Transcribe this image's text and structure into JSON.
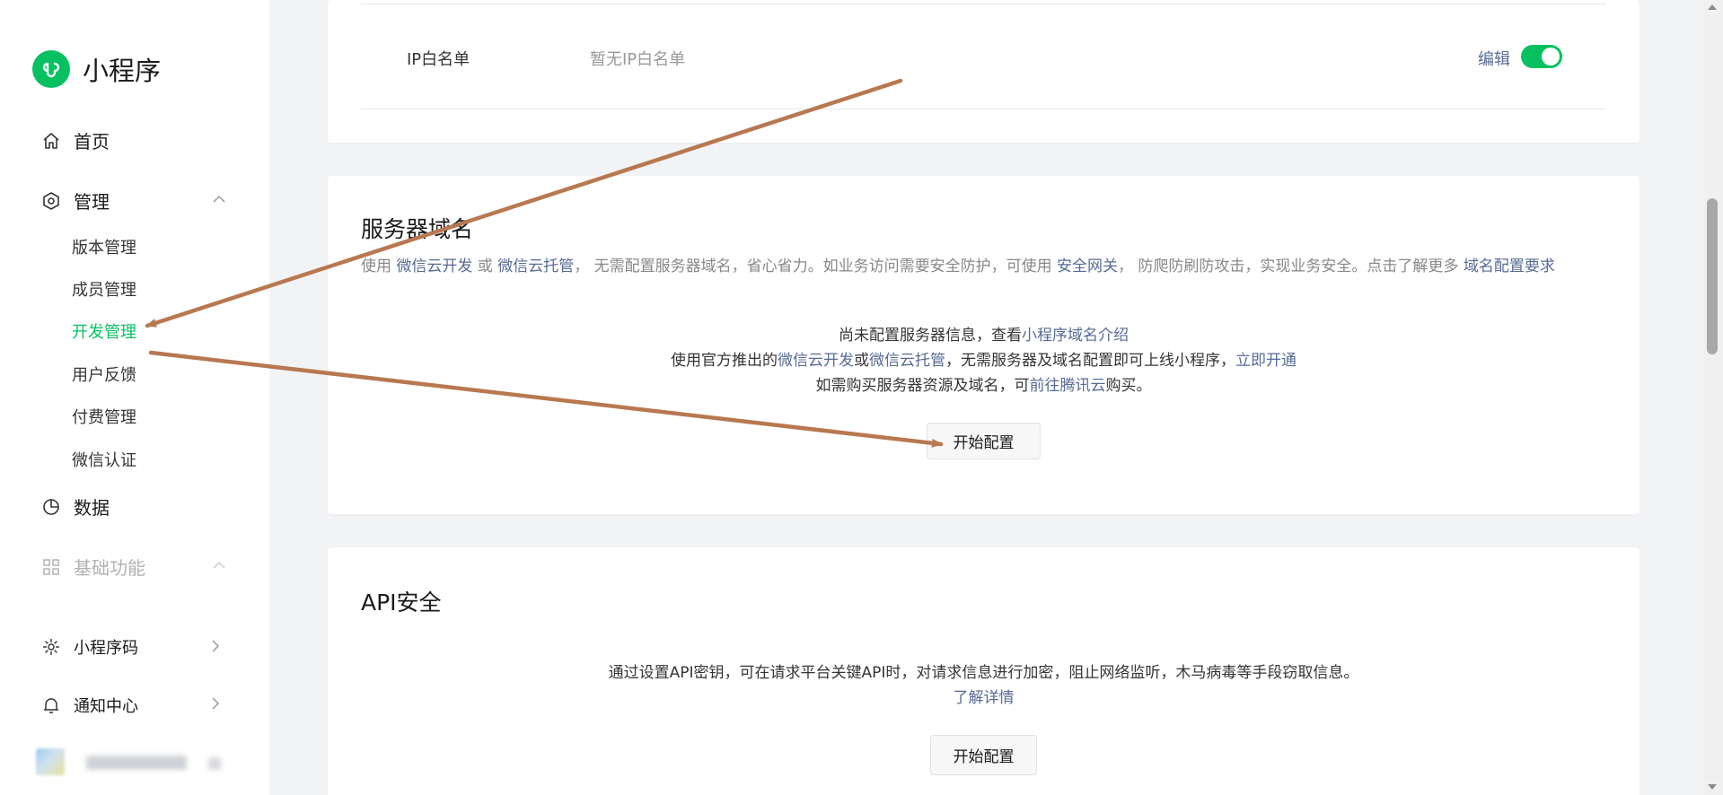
{
  "brand": {
    "name": "小程序",
    "logo_icon": "miniprogram-logo-icon",
    "color": "#07c160"
  },
  "sidebar": {
    "home": {
      "label": "首页",
      "icon": "home-icon"
    },
    "manage": {
      "label": "管理",
      "icon": "manage-icon",
      "items": [
        {
          "label": "版本管理"
        },
        {
          "label": "成员管理"
        },
        {
          "label": "开发管理",
          "active": true
        },
        {
          "label": "用户反馈"
        },
        {
          "label": "付费管理"
        },
        {
          "label": "微信认证"
        }
      ]
    },
    "data": {
      "label": "数据",
      "icon": "pie-chart-icon"
    },
    "basic": {
      "label": "基础功能",
      "icon": "grid-icon"
    },
    "qrcode": {
      "label": "小程序码",
      "icon": "qrcode-icon"
    },
    "notify": {
      "label": "通知中心",
      "icon": "bell-icon"
    }
  },
  "ip_whitelist": {
    "label": "IP白名单",
    "value": "暂无IP白名单",
    "edit": "编辑",
    "toggle_on": true
  },
  "server": {
    "title": "服务器域名",
    "desc_prefix": "使用 ",
    "desc_link1": "微信云开发",
    "desc_or": " 或 ",
    "desc_link2": "微信云托管",
    "desc_mid": "， 无需配置服务器域名，省心省力。如业务访问需要安全防护，可使用 ",
    "desc_link3": "安全网关",
    "desc_mid2": "， 防爬防刷防攻击，实现业务安全。点击了解更多 ",
    "desc_link4": "域名配置要求",
    "line1_prefix": "尚未配置服务器信息，查看",
    "line1_link": "小程序域名介绍",
    "line2_prefix": "使用官方推出的",
    "line2_link1": "微信云开发",
    "line2_or": "或",
    "line2_link2": "微信云托管",
    "line2_mid": "，无需服务器及域名配置即可上线小程序，",
    "line2_link3": "立即开通",
    "line3_prefix": "如需购买服务器资源及域名，可",
    "line3_link": "前往腾讯云",
    "line3_suffix": "购买。",
    "button": "开始配置"
  },
  "api": {
    "title": "API安全",
    "desc": "通过设置API密钥，可在请求平台关键API时，对请求信息进行加密，阻止网络监听，木马病毒等手段窃取信息。",
    "link": "了解详情",
    "button": "开始配置"
  },
  "colors": {
    "accent": "#07c160",
    "link": "#576b95",
    "annotation_arrow": "#b87850"
  }
}
